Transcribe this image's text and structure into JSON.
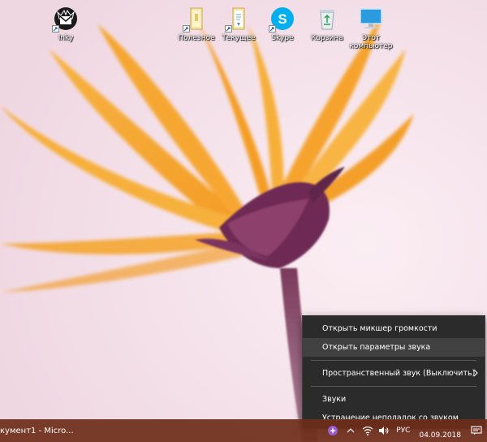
{
  "desktop": {
    "icons": [
      {
        "label": "Inky",
        "icon": "inky-mail-icon"
      },
      {
        "label": "Полезное",
        "icon": "folder-icon"
      },
      {
        "label": "Текущее",
        "icon": "folder-document-icon"
      },
      {
        "label": "Skype",
        "icon": "skype-icon"
      },
      {
        "label": "Корзина",
        "icon": "recycle-bin-icon"
      },
      {
        "label": "Этот компьютер",
        "icon": "computer-icon"
      }
    ]
  },
  "context_menu": {
    "items": [
      {
        "label": "Открыть микшер громкости"
      },
      {
        "label": "Открыть параметры звука",
        "highlighted": true
      },
      {
        "label": "Пространственный звук (Выключить)",
        "has_submenu": true
      },
      {
        "label": "Звуки"
      },
      {
        "label": "Устранение неполадок со звуком"
      }
    ]
  },
  "taskbar": {
    "active_app": "кумент1 - Micro...",
    "language": "РУС",
    "date": "04.09.2018",
    "tray_icons": [
      "color-dot-icon",
      "chevron-up-icon",
      "network-icon",
      "volume-icon",
      "notification-icon"
    ]
  },
  "colors": {
    "taskbar": "#6e2d19",
    "menu_bg": "#2b2b2b",
    "menu_hover": "#414141",
    "petal": "#f5a623"
  }
}
